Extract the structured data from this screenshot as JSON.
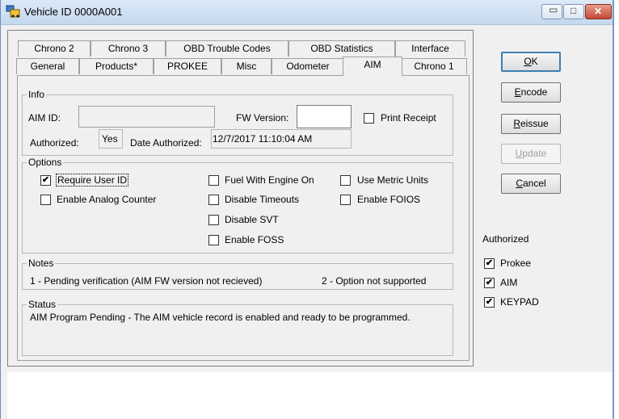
{
  "window": {
    "title": "Vehicle ID 0000A001",
    "minimize_glyph": "▭",
    "maximize_glyph": "□",
    "close_glyph": "✕"
  },
  "tabs": {
    "row1": [
      "Chrono 2",
      "Chrono 3",
      "OBD Trouble Codes",
      "OBD Statistics",
      "Interface"
    ],
    "row2": [
      "General",
      "Products*",
      "PROKEE",
      "Misc",
      "Odometer",
      "AIM",
      "Chrono 1"
    ],
    "selected": "AIM"
  },
  "info": {
    "group_label": "Info",
    "aim_id_label": "AIM ID:",
    "aim_id_value": "",
    "fw_version_label": "FW Version:",
    "fw_version_value": "",
    "print_receipt_label": "Print Receipt",
    "print_receipt_checked": false,
    "authorized_label": "Authorized:",
    "authorized_value": "Yes",
    "date_authorized_label": "Date Authorized:",
    "date_authorized_value": "12/7/2017 11:10:04 AM"
  },
  "options": {
    "group_label": "Options",
    "items": [
      {
        "label": "Require User ID",
        "checked": true
      },
      {
        "label": "Enable Analog Counter",
        "checked": false
      },
      {
        "label": "Fuel With Engine On",
        "checked": false
      },
      {
        "label": "Disable Timeouts",
        "checked": false
      },
      {
        "label": "Disable SVT",
        "checked": false
      },
      {
        "label": "Enable FOSS",
        "checked": false
      },
      {
        "label": "Use Metric Units",
        "checked": false
      },
      {
        "label": "Enable FOIOS",
        "checked": false
      }
    ]
  },
  "notes": {
    "group_label": "Notes",
    "note1": "1 - Pending verification (AIM FW version not recieved)",
    "note2": "2 - Option not supported"
  },
  "status": {
    "group_label": "Status",
    "text": "AIM Program Pending - The AIM vehicle record is enabled and ready to be programmed."
  },
  "buttons": {
    "ok": {
      "pre": "",
      "underline": "O",
      "post": "K"
    },
    "encode": {
      "pre": "",
      "underline": "E",
      "post": "ncode"
    },
    "reissue": {
      "pre": "",
      "underline": "R",
      "post": "eissue"
    },
    "update": {
      "pre": "",
      "underline": "U",
      "post": "pdate",
      "disabled": true
    },
    "cancel": {
      "pre": "",
      "underline": "C",
      "post": "ancel"
    }
  },
  "authorized_side": {
    "label": "Authorized",
    "items": [
      {
        "label": "Prokee",
        "checked": true
      },
      {
        "label": "AIM",
        "checked": true
      },
      {
        "label": "KEYPAD",
        "checked": true
      }
    ]
  },
  "colors": {
    "titlebar": "#c4d8ee",
    "close_button": "#c24a34",
    "default_button_border": "#3c7fb1"
  }
}
